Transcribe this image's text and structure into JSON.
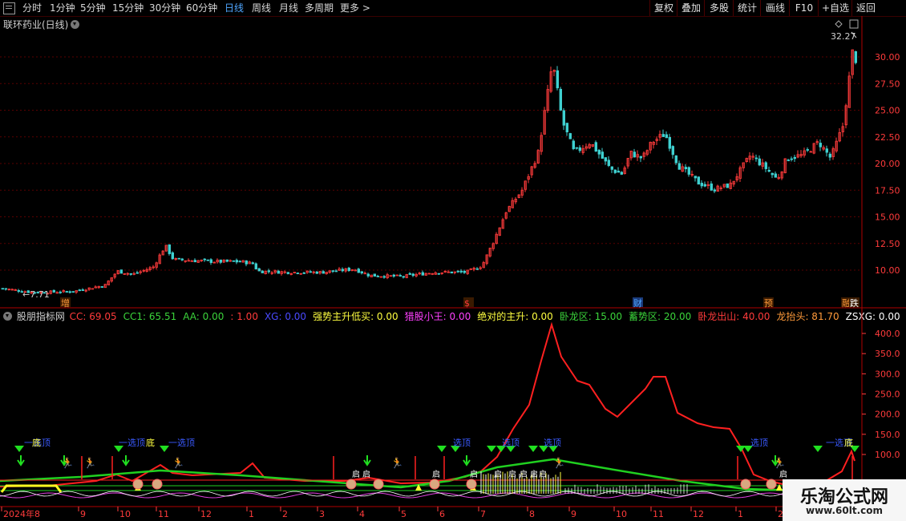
{
  "toolbar": {
    "periods": [
      "分时",
      "1分钟",
      "5分钟",
      "15分钟",
      "30分钟",
      "60分钟",
      "日线",
      "周线",
      "月线",
      "多周期",
      "更多 >"
    ],
    "active_period": "日线",
    "right_buttons": [
      "复权",
      "叠加",
      "多股",
      "统计",
      "画线",
      "F10",
      "+自选",
      "返回"
    ]
  },
  "main_panel": {
    "title": "联环药业(日线)",
    "high_label": "32.27",
    "low_label": "7.71",
    "price_ticks": [
      "30.00",
      "27.50",
      "25.00",
      "22.50",
      "20.00",
      "17.50",
      "15.00",
      "12.50",
      "10.00"
    ],
    "event_marks": [
      "增",
      "$",
      "财",
      "预",
      "融",
      "跌"
    ]
  },
  "indicator_panel": {
    "title": "股朋指标网",
    "values": [
      {
        "label": "CC:",
        "value": "69.05",
        "color": "#ff3b3b"
      },
      {
        "label": "CC1:",
        "value": "65.51",
        "color": "#3bd43b"
      },
      {
        "label": "AA:",
        "value": "0.00",
        "color": "#3bd43b"
      },
      {
        "label": ":",
        "value": "1.00",
        "color": "#ff3b3b"
      },
      {
        "label": "XG:",
        "value": "0.00",
        "color": "#4a4aff"
      },
      {
        "label": "强势主升低买:",
        "value": "0.00",
        "color": "#ffff40"
      },
      {
        "label": "猎股小王:",
        "value": "0.00",
        "color": "#ff40ff"
      },
      {
        "label": "绝对的主升:",
        "value": "0.00",
        "color": "#ffff40"
      },
      {
        "label": "卧龙区:",
        "value": "15.00",
        "color": "#3bd43b"
      },
      {
        "label": "蓄势区:",
        "value": "20.00",
        "color": "#3bd43b"
      },
      {
        "label": "卧龙出山:",
        "value": "40.00",
        "color": "#ff3b3b"
      },
      {
        "label": "龙抬头:",
        "value": "81.70",
        "color": "#ff9a3a"
      },
      {
        "label": "ZSXG:",
        "value": "0.00",
        "color": "#ffffff"
      }
    ],
    "y_ticks": [
      "400.0",
      "350.0",
      "300.0",
      "250.0",
      "200.0",
      "150.0",
      "100.0"
    ],
    "signal_labels": [
      "一选顶",
      "底",
      "底",
      "一选顶",
      "选顶",
      "启"
    ]
  },
  "time_axis": [
    "2024年8",
    "9",
    "10",
    "11",
    "12",
    "1",
    "2",
    "3",
    "4",
    "5",
    "6",
    "7",
    "8",
    "9",
    "10",
    "11",
    "12",
    "1",
    "2"
  ],
  "watermark": {
    "title": "乐淘公式网",
    "url": "www.60lt.com"
  },
  "colors": {
    "up": "#ff3b3b",
    "down": "#3fd0d0",
    "grid": "#5a0000",
    "axis": "#ff3b3b"
  }
}
